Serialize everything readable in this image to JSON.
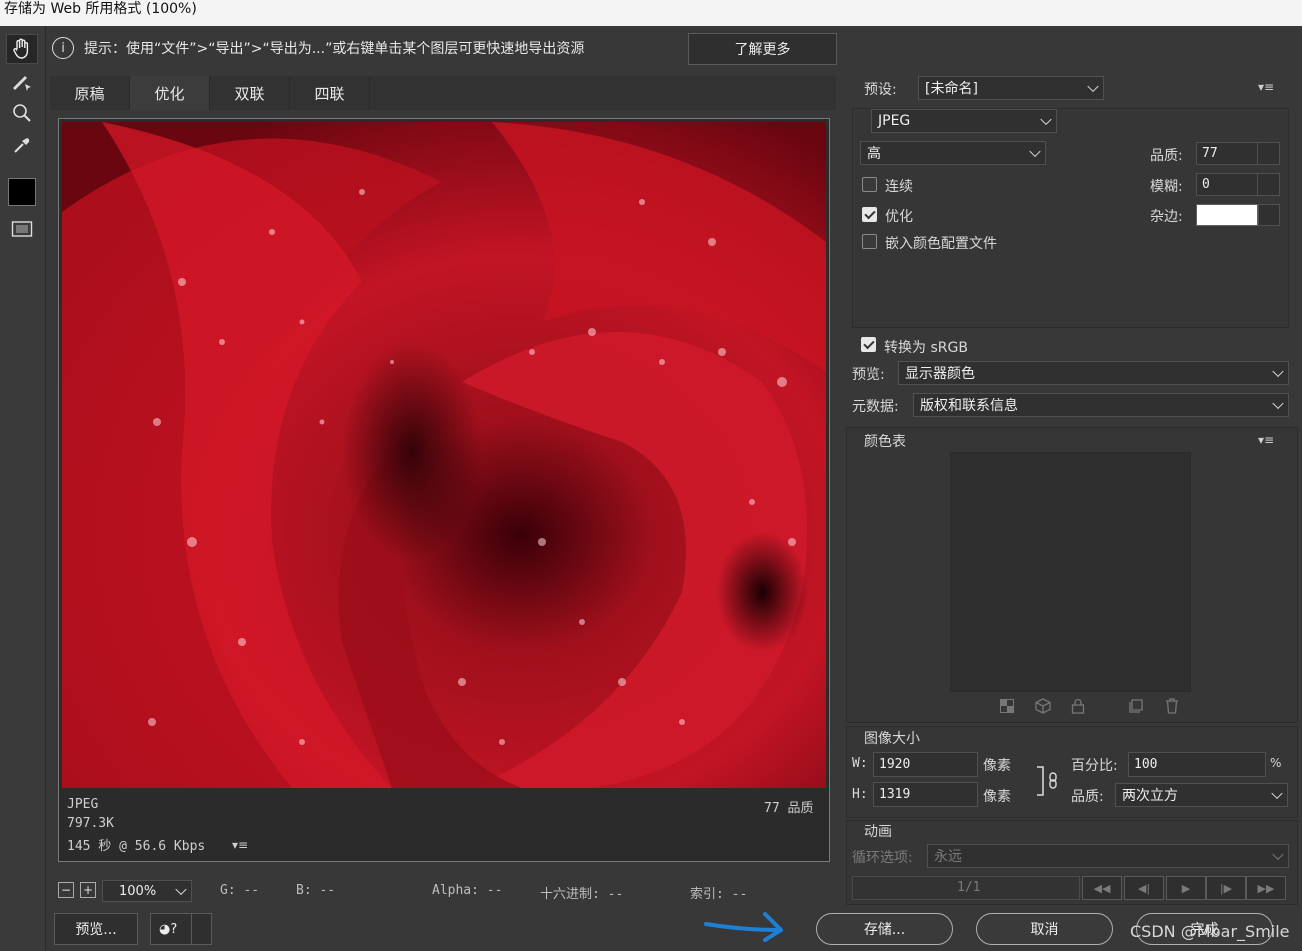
{
  "window": {
    "title": "存储为 Web 所用格式 (100%)"
  },
  "hint": {
    "text": "提示：使用“文件”>“导出”>“导出为...”或右键单击某个图层可更快速地导出资源",
    "learn_more": "了解更多"
  },
  "tabs": [
    {
      "label": "原稿"
    },
    {
      "label": "优化"
    },
    {
      "label": "双联"
    },
    {
      "label": "四联"
    }
  ],
  "image_info": {
    "format": "JPEG",
    "size": "797.3K",
    "time": "145 秒 @ 56.6 Kbps",
    "quality": "77 品质"
  },
  "settings": {
    "preset_label": "预设:",
    "preset_value": "[未命名]",
    "format_value": "JPEG",
    "quality_level": "高",
    "quality_label": "品质:",
    "quality_value": "77",
    "blur_label": "模糊:",
    "blur_value": "0",
    "matte_label": "杂边:",
    "matte_color": "#ffffff",
    "progressive_label": "连续",
    "progressive_checked": false,
    "optimized_label": "优化",
    "optimized_checked": true,
    "embed_profile_label": "嵌入颜色配置文件",
    "embed_profile_checked": false,
    "convert_srgb_label": "转换为 sRGB",
    "convert_srgb_checked": true,
    "preview_label": "预览:",
    "preview_value": "显示器颜色",
    "metadata_label": "元数据:",
    "metadata_value": "版权和联系信息"
  },
  "color_table": {
    "title": "颜色表"
  },
  "image_size": {
    "title": "图像大小",
    "w_label": "W:",
    "w_value": "1920",
    "h_label": "H:",
    "h_value": "1319",
    "unit": "像素",
    "percent_label": "百分比:",
    "percent_value": "100",
    "percent_sign": "%",
    "quality_label": "品质:",
    "quality_value": "两次立方"
  },
  "animation": {
    "title": "动画",
    "loop_label": "循环选项:",
    "loop_value": "永远",
    "frame": "1/1"
  },
  "status": {
    "zoom": "100%",
    "g": "G: --",
    "b": "B: --",
    "alpha": "Alpha: --",
    "hex": "十六进制: --",
    "index": "索引: --"
  },
  "buttons": {
    "preview": "预览...",
    "save": "存储...",
    "cancel": "取消",
    "done": "完成"
  },
  "watermark": "CSDN @Mbar_Smile",
  "colors": {
    "bg": "#383838",
    "accent_arrow": "#1e7fd6"
  }
}
